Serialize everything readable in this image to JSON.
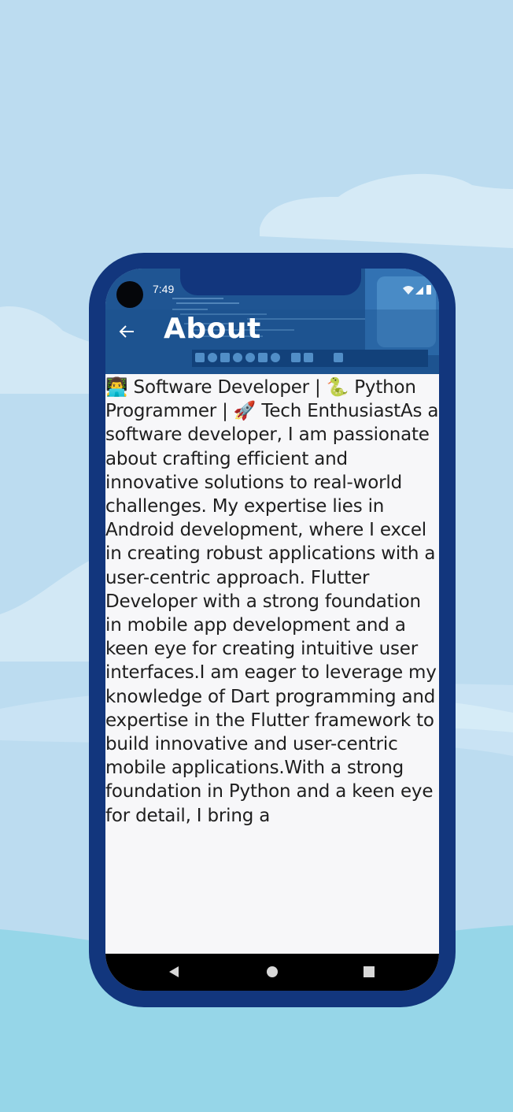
{
  "status_bar": {
    "time": "7:49"
  },
  "app_bar": {
    "title": "About",
    "back_icon": "arrow-left-icon"
  },
  "about": {
    "text": "👨‍💻 Software Developer | 🐍 Python Programmer | 🚀 Tech EnthusiastAs a software developer, I am passionate about crafting efficient and innovative solutions to real-world challenges. My expertise lies in Android development, where I excel in creating robust applications with a user-centric approach. Flutter Developer with a strong foundation in mobile app development and a keen eye for creating intuitive user interfaces.I am eager to leverage my knowledge of Dart programming and expertise in the Flutter framework to build innovative and user-centric mobile applications.With a strong foundation in Python and a keen eye for detail, I bring a"
  },
  "nav": {
    "back_icon": "triangle-back-icon",
    "home_icon": "circle-home-icon",
    "recents_icon": "square-recents-icon"
  },
  "colors": {
    "background": "#bcdcf0",
    "frame": "#12367d",
    "screen": "#f7f7f9",
    "text": "#1e1e1e"
  }
}
